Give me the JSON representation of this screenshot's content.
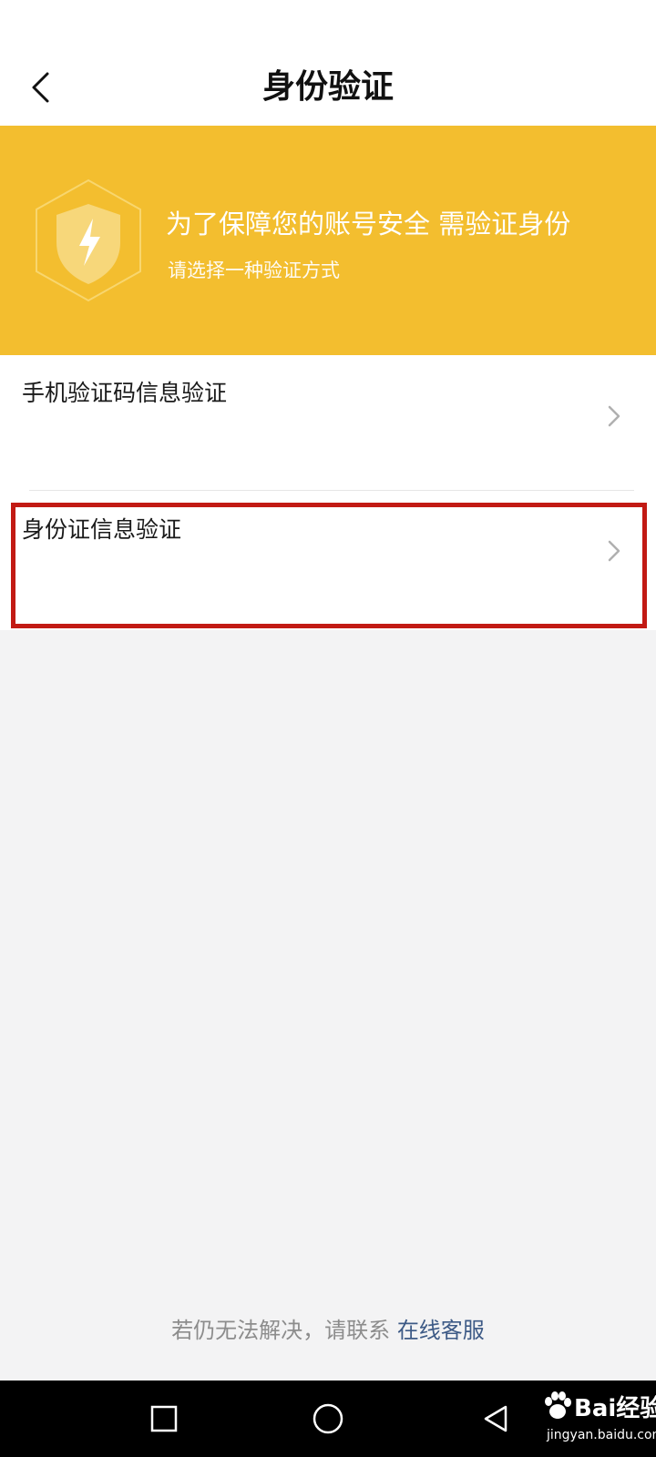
{
  "header": {
    "title": "身份验证",
    "back_icon": "chevron-left-icon"
  },
  "banner": {
    "icon": "shield-lightning-icon",
    "title": "为了保障您的账号安全 需验证身份",
    "subtitle": "请选择一种验证方式",
    "background_color": "#f3be2f"
  },
  "options": [
    {
      "label": "手机验证码信息验证",
      "icon": "chevron-right-icon"
    },
    {
      "label": "身份证信息验证",
      "icon": "chevron-right-icon",
      "highlighted": true
    }
  ],
  "help": {
    "text": "若仍无法解决，请联系",
    "link": "在线客服"
  },
  "navbar": {
    "buttons": [
      "square-icon",
      "circle-icon",
      "triangle-back-icon"
    ]
  },
  "watermark": {
    "brand": "Bai经验",
    "domain": "jingyan.baidu.com"
  },
  "colors": {
    "highlight_border": "#c21a14",
    "link": "#3d5a86"
  }
}
